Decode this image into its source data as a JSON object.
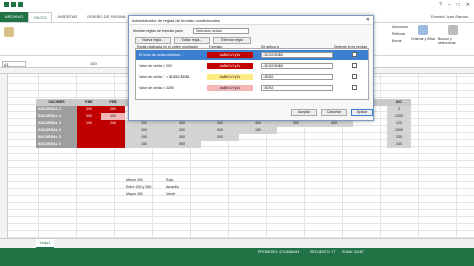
{
  "title_bar": {
    "qat": [
      "save-icon",
      "undo-icon",
      "redo-icon"
    ]
  },
  "tabs": [
    "ARCHIVO",
    "INICIO",
    "INSERTAR",
    "DISEÑO DE PÁGINA"
  ],
  "user": "Ernesto' Ivan Ramos",
  "ribbon": {
    "right": [
      "Autosuma",
      "Rellenar",
      "Borrar",
      "Ordenar y filtrar",
      "Buscar y seleccionar"
    ]
  },
  "formula": {
    "namebox": "A1",
    "fx": "100"
  },
  "table": {
    "header": [
      "SUC/MES",
      "ENE",
      "FEB"
    ],
    "hdr_right": "DIC",
    "rows": [
      {
        "name": "SUCURSAL 1",
        "ene": "300",
        "feb": "260",
        "dic": "3"
      },
      {
        "name": "SUCURSAL 2",
        "ene": "300",
        "feb": "450",
        "dic": "1200"
      },
      {
        "name": "SUCURSAL 3",
        "ene": "100",
        "feb": "240",
        "dic": "120"
      },
      {
        "name": "SUCURSAL 4",
        "ene": "",
        "feb": "",
        "dic": "1000"
      },
      {
        "name": "SUCURSAL 5",
        "ene": "",
        "feb": "",
        "dic": "230"
      },
      {
        "name": "SUCURSAL 6",
        "ene": "",
        "feb": "",
        "dic": "240"
      }
    ],
    "mid": [
      "200",
      "300",
      "300",
      "400",
      "300",
      "400",
      "200",
      "200",
      "500",
      "150",
      "150",
      "300",
      "200",
      "150",
      "500"
    ]
  },
  "legend": [
    {
      "label": "Menor 200",
      "color": "Rojo"
    },
    {
      "label": "Entre 200 y 350",
      "color": "Amarillo"
    },
    {
      "label": "Mayor 350",
      "color": "Verde"
    }
  ],
  "sheet": "Hoja1",
  "status": {
    "avg": "PROMEDIO: 474,8484444",
    "count": "RECUENTO: 77",
    "sum": "SUMA: 34187"
  },
  "dialog": {
    "title": "Administrador de reglas de formato condicionales",
    "show_label": "Mostrar reglas de formato para:",
    "show_value": "Selección actual",
    "btn_new": "Nueva regla...",
    "btn_edit": "Editar regla...",
    "btn_delete": "Eliminar regla",
    "col_rule": "Regla (aplicada en el orden mostrado)",
    "col_format": "Formato",
    "col_applies": "Se aplica a",
    "col_stop": "Detener si es verdad",
    "rules": [
      {
        "rule": "El texto de celda contiene...",
        "format": "AaBbCcYyZz",
        "applies": "=$C$3:$N$8"
      },
      {
        "rule": "Valor de celda < 200",
        "format": "AaBbCcYyZz",
        "applies": "=$C$3:$N$8"
      },
      {
        "rule": "Valor de celda ' ' = $D$52:$D$8",
        "format": "AaBbCcYyZz",
        "applies": "=$D$3"
      },
      {
        "rule": "Valor de celda > 3250",
        "format": "AaBbCcYyZz",
        "applies": "=$D$3"
      }
    ],
    "ok": "Aceptar",
    "cancel": "Cancelar",
    "apply": "Aplicar"
  },
  "colors": {
    "green": "#217346",
    "red": "#c00000",
    "yellow": "#ffeb84",
    "pink": "#f4b6b6"
  }
}
